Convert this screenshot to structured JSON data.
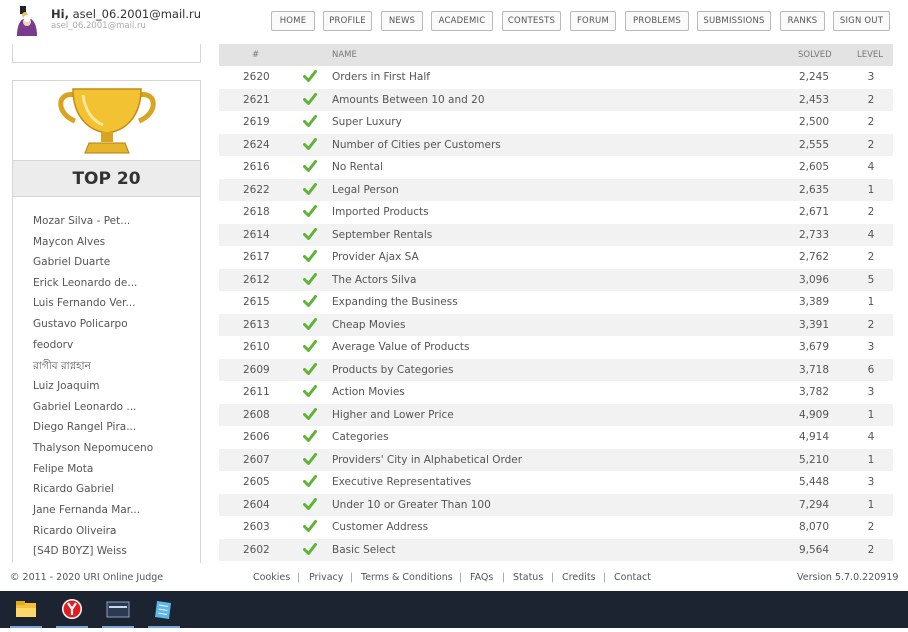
{
  "header": {
    "greeting_prefix": "Hi,",
    "username": "asel_06.2001@mail.ru",
    "email": "asel_06.2001@mail.ru",
    "avatar_icon": "user-avatar-icon"
  },
  "nav": [
    {
      "key": "home",
      "label": "HOME"
    },
    {
      "key": "profile",
      "label": "PROFILE"
    },
    {
      "key": "news",
      "label": "NEWS"
    },
    {
      "key": "academic",
      "label": "ACADEMIC"
    },
    {
      "key": "contests",
      "label": "CONTESTS"
    },
    {
      "key": "forum",
      "label": "FORUM"
    },
    {
      "key": "problems",
      "label": "PROBLEMS"
    },
    {
      "key": "submissions",
      "label": "SUBMISSIONS"
    },
    {
      "key": "ranks",
      "label": "RANKS"
    },
    {
      "key": "signout",
      "label": "SIGN OUT"
    }
  ],
  "sidebar": {
    "top_title": "TOP 20",
    "trophy_icon": "trophy-icon",
    "top_users": [
      "Mozar Silva - Pet...",
      "Maycon Alves",
      "Gabriel Duarte",
      "Erick Leonardo de...",
      "Luis Fernando Ver...",
      "Gustavo Policarpo",
      "feodorv",
      "রাগীব রাগ্নহান",
      "Luiz Joaquim",
      "Gabriel Leonardo ...",
      "Diego Rangel Pira...",
      "Thalyson Nepomuceno",
      "Felipe Mota",
      "Ricardo Gabriel",
      "Jane Fernanda Mar...",
      "Ricardo Oliveira",
      "[S4D B0YZ] Weiss"
    ]
  },
  "table": {
    "columns": {
      "id": "#",
      "name": "NAME",
      "solved": "SOLVED",
      "level": "LEVEL"
    },
    "status_icon": "check-icon",
    "status_color": "#5fb336",
    "rows": [
      {
        "id": "2620",
        "name": "Orders in First Half",
        "solved": "2,245",
        "level": "3"
      },
      {
        "id": "2621",
        "name": "Amounts Between 10 and 20",
        "solved": "2,453",
        "level": "2"
      },
      {
        "id": "2619",
        "name": "Super Luxury",
        "solved": "2,500",
        "level": "2"
      },
      {
        "id": "2624",
        "name": "Number of Cities per Customers",
        "solved": "2,555",
        "level": "2"
      },
      {
        "id": "2616",
        "name": "No Rental",
        "solved": "2,605",
        "level": "4"
      },
      {
        "id": "2622",
        "name": "Legal Person",
        "solved": "2,635",
        "level": "1"
      },
      {
        "id": "2618",
        "name": "Imported Products",
        "solved": "2,671",
        "level": "2"
      },
      {
        "id": "2614",
        "name": "September Rentals",
        "solved": "2,733",
        "level": "4"
      },
      {
        "id": "2617",
        "name": "Provider Ajax SA",
        "solved": "2,762",
        "level": "2"
      },
      {
        "id": "2612",
        "name": "The Actors Silva",
        "solved": "3,096",
        "level": "5"
      },
      {
        "id": "2615",
        "name": "Expanding the Business",
        "solved": "3,389",
        "level": "1"
      },
      {
        "id": "2613",
        "name": "Cheap Movies",
        "solved": "3,391",
        "level": "2"
      },
      {
        "id": "2610",
        "name": "Average Value of Products",
        "solved": "3,679",
        "level": "3"
      },
      {
        "id": "2609",
        "name": "Products by Categories",
        "solved": "3,718",
        "level": "6"
      },
      {
        "id": "2611",
        "name": "Action Movies",
        "solved": "3,782",
        "level": "3"
      },
      {
        "id": "2608",
        "name": "Higher and Lower Price",
        "solved": "4,909",
        "level": "1"
      },
      {
        "id": "2606",
        "name": "Categories",
        "solved": "4,914",
        "level": "4"
      },
      {
        "id": "2607",
        "name": "Providers' City in Alphabetical Order",
        "solved": "5,210",
        "level": "1"
      },
      {
        "id": "2605",
        "name": "Executive Representatives",
        "solved": "5,448",
        "level": "3"
      },
      {
        "id": "2604",
        "name": "Under 10 or Greater Than 100",
        "solved": "7,294",
        "level": "1"
      },
      {
        "id": "2603",
        "name": "Customer Address",
        "solved": "8,070",
        "level": "2"
      },
      {
        "id": "2602",
        "name": "Basic Select",
        "solved": "9,564",
        "level": "2"
      }
    ]
  },
  "footer": {
    "copyright": "© 2011 - 2020 URI Online Judge",
    "links": [
      "Cookies",
      "Privacy",
      "Terms & Conditions",
      "FAQs",
      "Status",
      "Credits",
      "Contact"
    ],
    "separator": "|",
    "version": "Version 5.7.0.220919"
  },
  "taskbar": {
    "icons": [
      "file-explorer-icon",
      "yandex-browser-icon",
      "app-window-icon",
      "notepad-icon"
    ]
  }
}
